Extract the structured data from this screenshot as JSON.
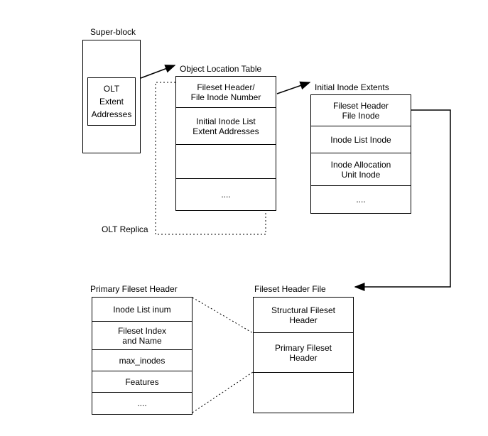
{
  "labels": {
    "superblock": "Super-block",
    "olt": "Object Location Table",
    "initialInodeExtents": "Initial Inode Extents",
    "oltReplica": "OLT Replica",
    "primaryFilesetHeader": "Primary Fileset Header",
    "filesetHeaderFile": "Fileset Header File"
  },
  "superblock": {
    "inner": "OLT\nExtent\nAddresses"
  },
  "olt": {
    "rows": [
      "Fileset Header/\nFile Inode Number",
      "Initial Inode List\nExtent Addresses",
      "",
      "...."
    ]
  },
  "initialInode": {
    "rows": [
      "Fileset Header\nFile Inode",
      "Inode List Inode",
      "Inode Allocation\nUnit Inode",
      "...."
    ]
  },
  "primaryFileset": {
    "rows": [
      "Inode List inum",
      "Fileset Index\nand Name",
      "max_inodes",
      "Features",
      "...."
    ]
  },
  "filesetHeaderFile": {
    "rows": [
      "Structural Fileset\nHeader",
      "Primary Fileset\nHeader",
      ""
    ]
  }
}
